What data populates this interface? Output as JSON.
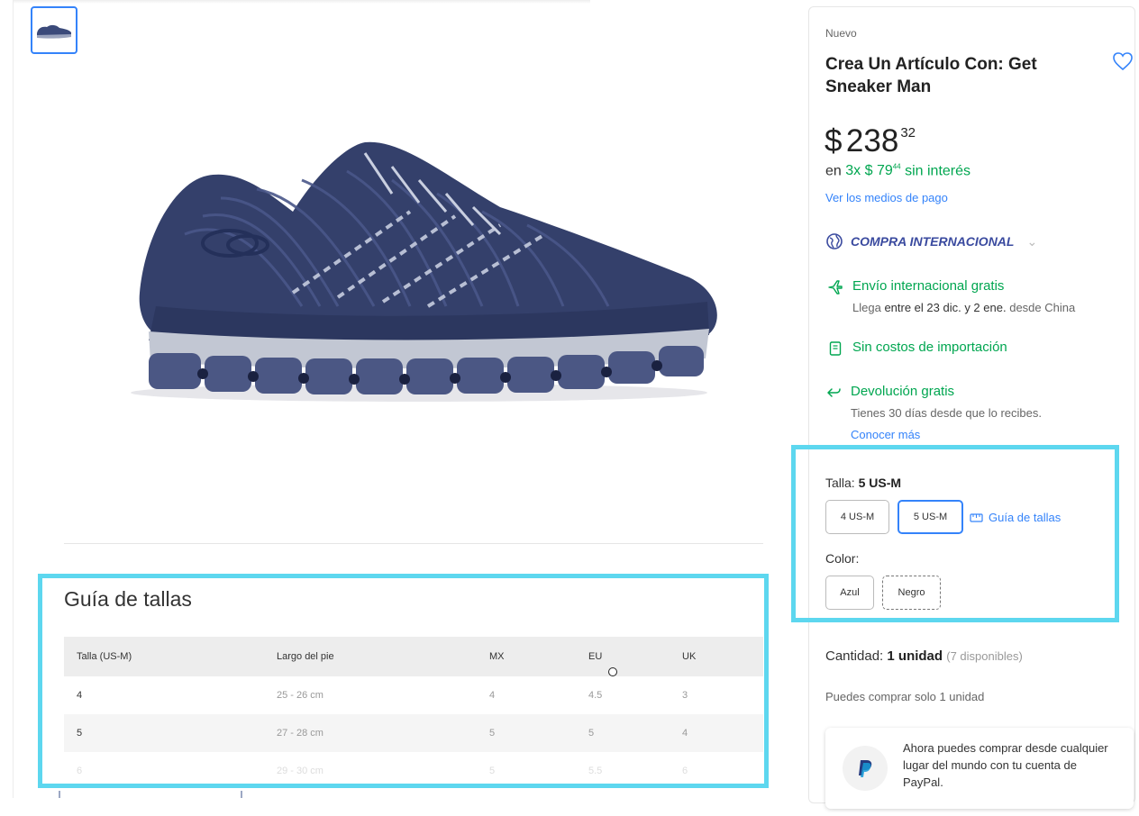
{
  "gallery": {
    "thumbnail_alt": "sneaker thumbnail",
    "main_image_alt": "navy blue running sneaker"
  },
  "size_guide": {
    "title": "Guía de tallas",
    "columns": [
      "Talla (US-M)",
      "Largo del pie",
      "MX",
      "EU",
      "UK"
    ],
    "rows": [
      [
        "4",
        "25 - 26 cm",
        "4",
        "4.5",
        "3"
      ],
      [
        "5",
        "27 - 28 cm",
        "5",
        "5",
        "4"
      ],
      [
        "6",
        "29 - 30 cm",
        "5",
        "5.5",
        "6"
      ]
    ]
  },
  "product": {
    "condition": "Nuevo",
    "title": "Crea Un Artículo Con: Get Sneaker Man",
    "price_symbol": "$",
    "price_integer": "238",
    "price_cents": "32",
    "installments_prefix": "en",
    "installments_amount": "3x $ 79",
    "installments_cents": "44",
    "installments_suffix": "sin interés",
    "payment_methods_link": "Ver los medios de pago",
    "international_label": "COMPRA INTERNACIONAL"
  },
  "shipping": {
    "title": "Envío internacional gratis",
    "arrival_prefix": "Llega",
    "arrival_dates": "entre el 23 dic. y 2 ene.",
    "arrival_origin": "desde China"
  },
  "import_costs": {
    "title": "Sin costos de importación"
  },
  "returns": {
    "title": "Devolución gratis",
    "subtitle": "Tienes 30 días desde que lo recibes.",
    "link": "Conocer más"
  },
  "variations": {
    "size_label": "Talla:",
    "size_selected": "5 US-M",
    "size_options": [
      "4 US-M",
      "5 US-M"
    ],
    "size_guide_link": "Guía de tallas",
    "color_label": "Color:",
    "color_options": [
      "Azul",
      "Negro"
    ]
  },
  "quantity": {
    "label": "Cantidad:",
    "value": "1 unidad",
    "available": "(7 disponibles)",
    "limit_note": "Puedes comprar solo 1 unidad"
  },
  "paypal": {
    "message": "Ahora puedes comprar desde cualquier lugar del mundo con tu cuenta de PayPal."
  },
  "colors": {
    "accent": "#3483fa",
    "green": "#00a650",
    "highlight": "#5dd7ef",
    "shoe": "#3b4a7a"
  }
}
